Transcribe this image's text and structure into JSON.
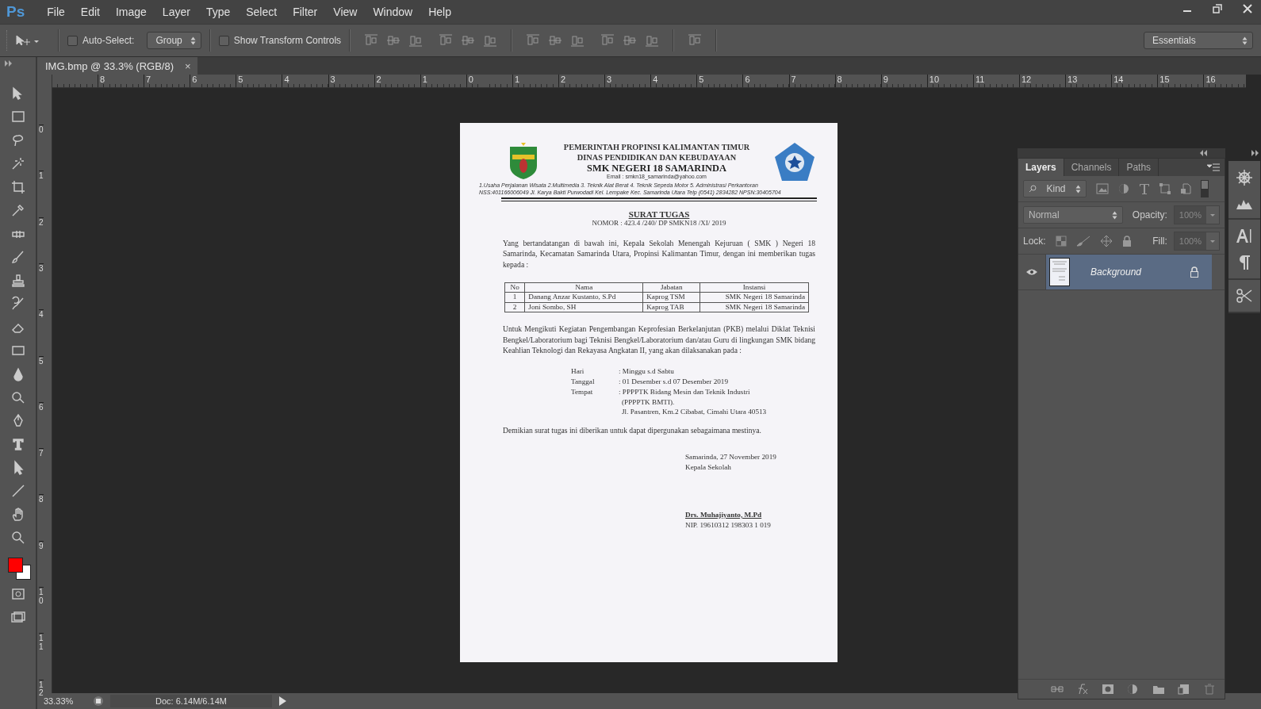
{
  "app": {
    "logo": "Ps"
  },
  "menu": [
    "File",
    "Edit",
    "Image",
    "Layer",
    "Type",
    "Select",
    "Filter",
    "View",
    "Window",
    "Help"
  ],
  "options_bar": {
    "auto_select": {
      "label": "Auto-Select:",
      "checked": false
    },
    "target": "Group",
    "show_transform": {
      "label": "Show Transform Controls",
      "checked": false
    },
    "workspace": "Essentials"
  },
  "document_tab": {
    "title": "IMG.bmp @ 33.3% (RGB/8)",
    "close": "×"
  },
  "rulers": {
    "horizontal": [
      "8",
      "7",
      "6",
      "5",
      "4",
      "3",
      "2",
      "1",
      "0",
      "1",
      "2",
      "3",
      "4",
      "5",
      "6",
      "7",
      "8",
      "9",
      "10",
      "11",
      "12",
      "13",
      "14",
      "15",
      "16"
    ],
    "vertical": [
      "0",
      "1",
      "2",
      "3",
      "4",
      "5",
      "6",
      "7",
      "8",
      "9",
      "10",
      "11",
      "12"
    ]
  },
  "letter": {
    "header": [
      "PEMERINTAH PROPINSI KALIMANTAN TIMUR",
      "DINAS PENDIDIKAN DAN KEBUDAYAAN",
      "SMK NEGERI 18 SAMARINDA"
    ],
    "email": "Email : smkn18_samarinda@yahoo.com",
    "programs": "1.Usaha Perjalanan Wisata  2.Multimedia 3. Teknik Alat Berat  4. Teknik Sepeda Motor  5. Administrasi Perkantoran",
    "address": "NSS:401166006049   Jl. Karya Bakti Purwodadi  Kel. Lempake Kec. Samarinda Utara Telp (0541) 2834282       NPSN:30405704",
    "title": "SURAT TUGAS",
    "number": "NOMOR : 423.4 /240/ DP SMKN18 /XI/ 2019",
    "intro": "Yang bertandatangan di bawah ini, Kepala Sekolah Menengah Kejuruan ( SMK ) Negeri 18 Samarinda, Kecamatan Samarinda Utara, Propinsi Kalimantan Timur, dengan ini memberikan tugas kepada :",
    "table": {
      "columns": [
        "No",
        "Nama",
        "Jabatan",
        "Instansi"
      ],
      "rows": [
        [
          "1",
          "Danang Anzar Kustanto, S.Pd",
          "Kaprog TSM",
          "SMK Negeri 18 Samarinda"
        ],
        [
          "2",
          "Joni Sombo, SH",
          "Kaprog TAB",
          "SMK Negeri 18 Samarinda"
        ]
      ]
    },
    "purpose": "Untuk Mengikuti Kegiatan Pengembangan Keprofesian Berkelanjutan (PKB) melalui Diklat Teknisi Bengkel/Laboratorium bagi Teknisi Bengkel/Laboratorium dan/atau Guru di lingkungan SMK bidang Keahlian Teknologi dan Rekayasa Angkatan II, yang akan dilaksanakan pada :",
    "details": [
      {
        "label": "Hari",
        "lines": [
          ": Minggu s.d Sabtu"
        ]
      },
      {
        "label": "Tanggal",
        "lines": [
          ": 01 Desember s.d 07 Desember 2019"
        ]
      },
      {
        "label": "Tempat",
        "lines": [
          ": PPPPTK Bidang Mesin dan Teknik Industri",
          "(PPPPTK BMTI).",
          "Jl. Pasantren, Km.2 Cibabat, Cimahi Utara 40513"
        ]
      }
    ],
    "closing": "Demikian surat tugas ini diberikan untuk dapat dipergunakan sebagaimana mestinya.",
    "place_date": "Samarinda, 27 November 2019",
    "position": "Kepala Sekolah",
    "signer": "Drs. Muhajiyanto, M.Pd",
    "nip": "NIP. 19610312 198303 1 019"
  },
  "layers_panel": {
    "tabs": [
      {
        "label": "Layers",
        "selected": true
      },
      {
        "label": "Channels",
        "selected": false
      },
      {
        "label": "Paths",
        "selected": false
      }
    ],
    "filter": "Kind",
    "blend_mode": "Normal",
    "opacity_label": "Opacity:",
    "opacity": "100%",
    "lock_label": "Lock:",
    "fill_label": "Fill:",
    "fill": "100%",
    "layers": [
      {
        "name": "Background",
        "visible": true,
        "selected": true,
        "locked": true
      }
    ]
  },
  "status_bar": {
    "zoom": "33.33%",
    "doc": "Doc: 6.14M/6.14M"
  }
}
